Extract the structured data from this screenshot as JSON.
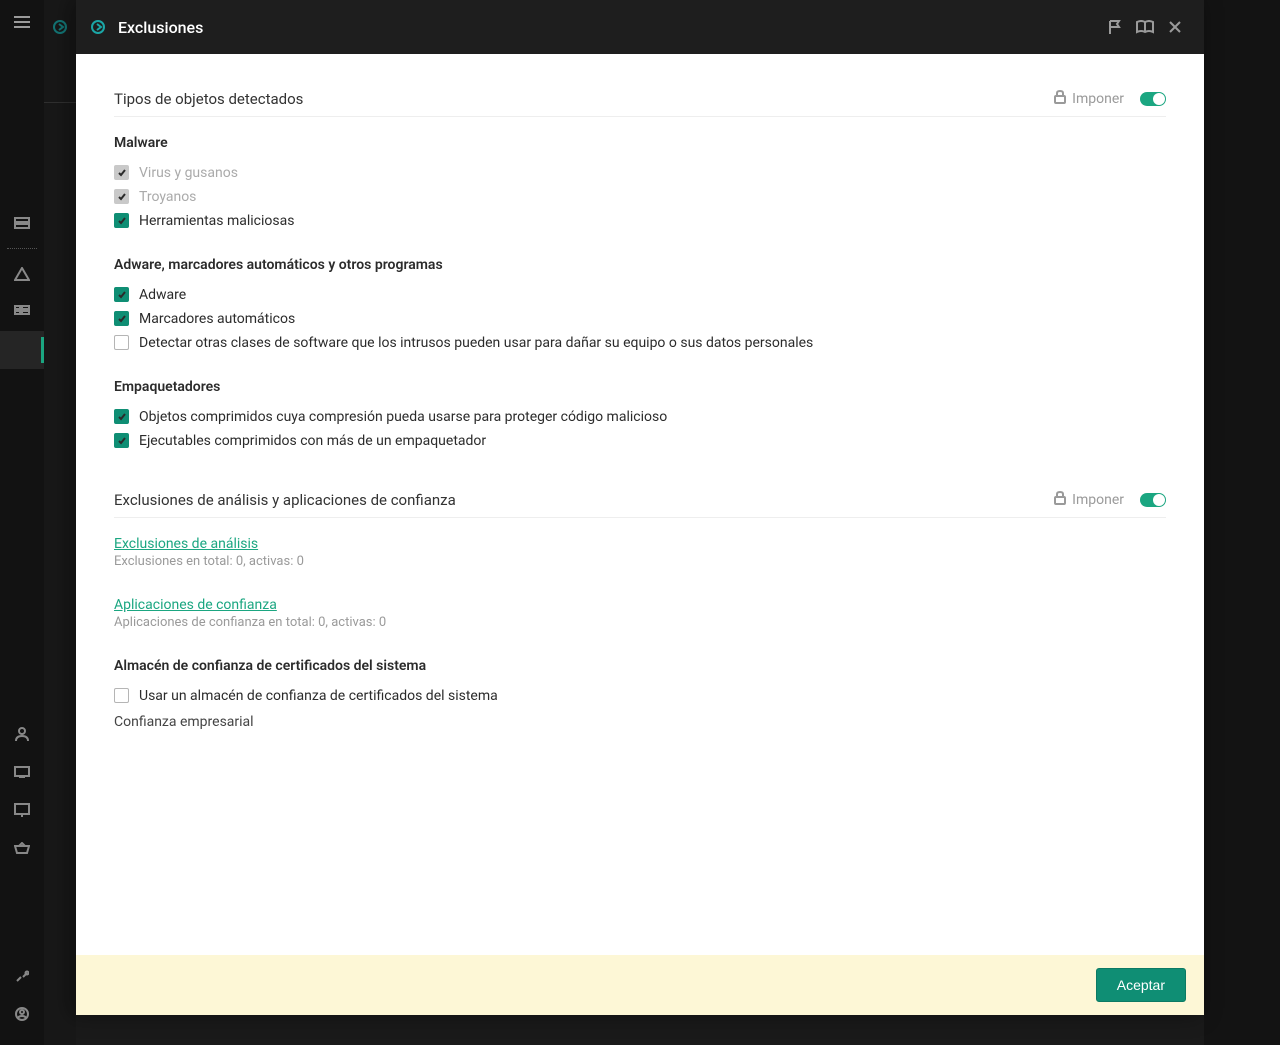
{
  "header": {
    "title": "Exclusiones"
  },
  "sections": {
    "detected": {
      "title": "Tipos de objetos detectados",
      "enforce": "Imponer"
    },
    "exclusions": {
      "title": "Exclusiones de análisis y aplicaciones de confianza",
      "enforce": "Imponer"
    }
  },
  "groups": {
    "malware": {
      "title": "Malware",
      "items": {
        "virus": "Virus y gusanos",
        "trojans": "Troyanos",
        "maltools": "Herramientas maliciosas"
      }
    },
    "adware": {
      "title": "Adware, marcadores automáticos y otros programas",
      "items": {
        "adware": "Adware",
        "dialers": "Marcadores automáticos",
        "other": "Detectar otras clases de software que los intrusos pueden usar para dañar su equipo o sus datos personales"
      }
    },
    "packers": {
      "title": "Empaquetadores",
      "items": {
        "packed_protect": "Objetos comprimidos cuya compresión pueda usarse para proteger código malicioso",
        "multi_packed": "Ejecutables comprimidos con más de un empaquetador"
      }
    },
    "store": {
      "title": "Almacén de confianza de certificados del sistema",
      "use_store": "Usar un almacén de confianza de certificados del sistema",
      "readonly": "Confianza empresarial"
    }
  },
  "links": {
    "scan_excl": {
      "label": "Exclusiones de análisis",
      "note": "Exclusiones en total: 0, activas: 0"
    },
    "trusted_apps": {
      "label": "Aplicaciones de confianza",
      "note": "Aplicaciones de confianza en total: 0, activas: 0"
    }
  },
  "footer": {
    "accept": "Aceptar"
  }
}
